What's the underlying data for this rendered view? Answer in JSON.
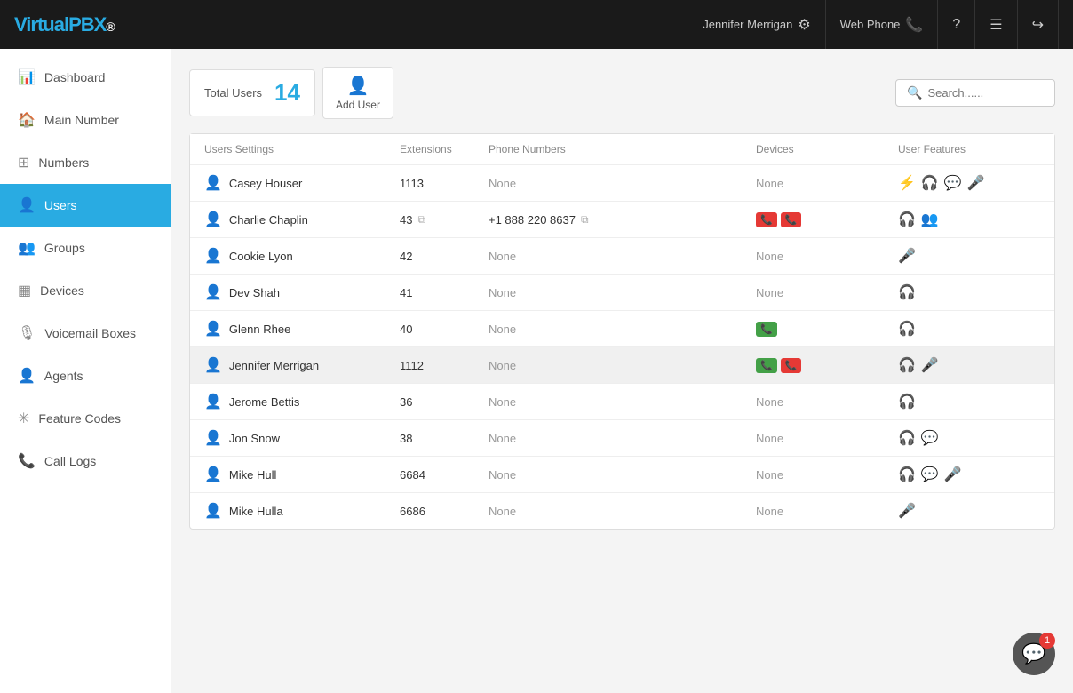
{
  "header": {
    "logo_virtual": "Virtual",
    "logo_pbx": "PBX",
    "user_name": "Jennifer Merrigan",
    "web_phone_label": "Web Phone",
    "help_icon": "?",
    "menu_icon": "☰",
    "logout_icon": "→"
  },
  "sidebar": {
    "items": [
      {
        "id": "dashboard",
        "label": "Dashboard",
        "icon": "📊",
        "active": false
      },
      {
        "id": "main-number",
        "label": "Main Number",
        "icon": "🏠",
        "active": false
      },
      {
        "id": "numbers",
        "label": "Numbers",
        "icon": "⊞",
        "active": false
      },
      {
        "id": "users",
        "label": "Users",
        "icon": "👤",
        "active": true
      },
      {
        "id": "groups",
        "label": "Groups",
        "icon": "👥",
        "active": false
      },
      {
        "id": "devices",
        "label": "Devices",
        "icon": "▦",
        "active": false
      },
      {
        "id": "voicemail-boxes",
        "label": "Voicemail Boxes",
        "icon": "🎙",
        "active": false
      },
      {
        "id": "agents",
        "label": "Agents",
        "icon": "👤",
        "active": false
      },
      {
        "id": "feature-codes",
        "label": "Feature Codes",
        "icon": "✳",
        "active": false
      },
      {
        "id": "call-logs",
        "label": "Call Logs",
        "icon": "📞",
        "active": false
      }
    ]
  },
  "topbar": {
    "total_label": "Total Users",
    "total_count": "14",
    "add_user_label": "Add User",
    "search_placeholder": "Search......"
  },
  "table": {
    "headers": {
      "users_settings": "Users Settings",
      "extensions": "Extensions",
      "phone_numbers": "Phone Numbers",
      "devices": "Devices",
      "user_features": "User Features"
    },
    "rows": [
      {
        "id": "casey-houser",
        "name": "Casey Houser",
        "admin": true,
        "extension": "1113",
        "has_copy": false,
        "phone": "None",
        "has_phone_copy": false,
        "devices": [],
        "device_none": "None",
        "features": [
          "yellow_bolt",
          "green_headset",
          "chat_bubble",
          "blue_mic"
        ]
      },
      {
        "id": "charlie-chaplin",
        "name": "Charlie Chaplin",
        "admin": false,
        "extension": "43",
        "has_copy": true,
        "phone": "+1 888 220 8637",
        "has_phone_copy": true,
        "devices": [
          "red_phone",
          "red_phone2"
        ],
        "device_none": "",
        "features": [
          "green_headset",
          "purple_group"
        ]
      },
      {
        "id": "cookie-lyon",
        "name": "Cookie Lyon",
        "admin": false,
        "extension": "42",
        "has_copy": false,
        "phone": "None",
        "has_phone_copy": false,
        "devices": [],
        "device_none": "None",
        "features": [
          "blue_mic"
        ]
      },
      {
        "id": "dev-shah",
        "name": "Dev Shah",
        "admin": false,
        "extension": "41",
        "has_copy": false,
        "phone": "None",
        "has_phone_copy": false,
        "devices": [],
        "device_none": "None",
        "features": [
          "green_headset"
        ]
      },
      {
        "id": "glenn-rhee",
        "name": "Glenn Rhee",
        "admin": false,
        "extension": "40",
        "has_copy": false,
        "phone": "None",
        "has_phone_copy": false,
        "devices": [
          "green_phone"
        ],
        "device_none": "",
        "features": [
          "green_headset"
        ]
      },
      {
        "id": "jennifer-merrigan",
        "name": "Jennifer Merrigan",
        "admin": true,
        "extension": "1112",
        "has_copy": false,
        "phone": "None",
        "has_phone_copy": false,
        "devices": [
          "green_phone",
          "red_phone"
        ],
        "device_none": "",
        "features": [
          "green_headset",
          "blue_mic"
        ],
        "highlighted": true
      },
      {
        "id": "jerome-bettis",
        "name": "Jerome Bettis",
        "admin": false,
        "extension": "36",
        "has_copy": false,
        "phone": "None",
        "has_phone_copy": false,
        "devices": [],
        "device_none": "None",
        "features": [
          "green_headset"
        ]
      },
      {
        "id": "jon-snow",
        "name": "Jon Snow",
        "admin": false,
        "extension": "38",
        "has_copy": false,
        "phone": "None",
        "has_phone_copy": false,
        "devices": [],
        "device_none": "None",
        "features": [
          "green_headset",
          "chat_bubble"
        ]
      },
      {
        "id": "mike-hull",
        "name": "Mike Hull",
        "admin": true,
        "extension": "6684",
        "has_copy": false,
        "phone": "None",
        "has_phone_copy": false,
        "devices": [],
        "device_none": "None",
        "features": [
          "green_headset",
          "chat_bubble",
          "blue_mic"
        ]
      },
      {
        "id": "mike-hulla",
        "name": "Mike Hulla",
        "admin": false,
        "extension": "6686",
        "has_copy": false,
        "phone": "None",
        "has_phone_copy": false,
        "devices": [],
        "device_none": "None",
        "features": [
          "blue_mic"
        ]
      }
    ]
  },
  "chat_widget": {
    "badge": "1"
  }
}
